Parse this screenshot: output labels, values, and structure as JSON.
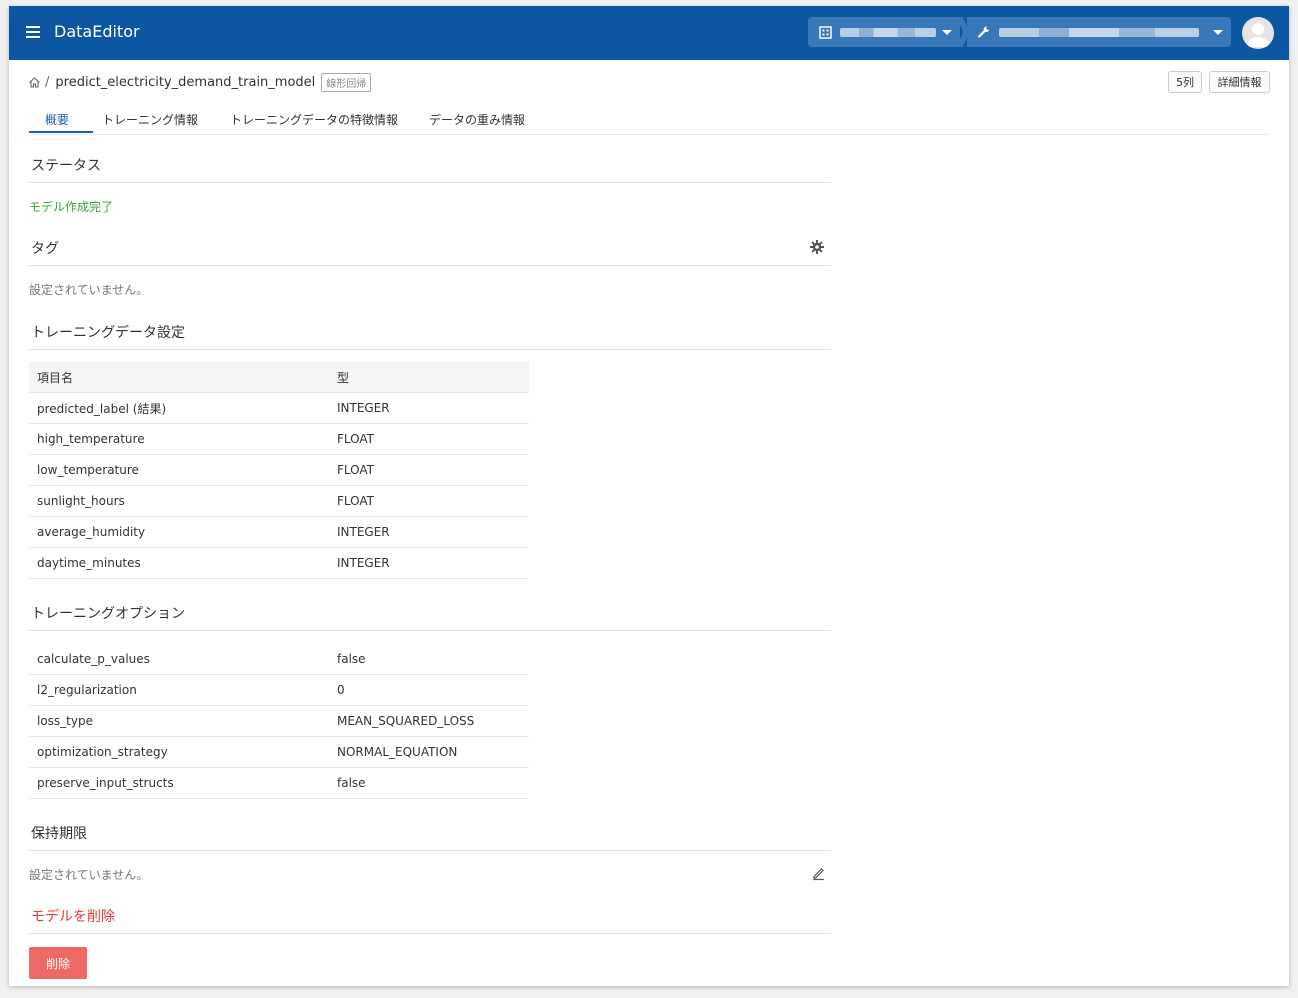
{
  "appbar": {
    "title": "DataEditor"
  },
  "breadcrumb": {
    "model_name": "predict_electricity_demand_train_model",
    "model_type": "線形回帰",
    "separator": "/"
  },
  "actions": {
    "columns_label": "5列",
    "details_label": "詳細情報"
  },
  "tabs": [
    {
      "label": "概要"
    },
    {
      "label": "トレーニング情報"
    },
    {
      "label": "トレーニングデータの特徴情報"
    },
    {
      "label": "データの重み情報"
    }
  ],
  "status": {
    "title": "ステータス",
    "value": "モデル作成完了"
  },
  "tags": {
    "title": "タグ",
    "empty_text": "設定されていません。"
  },
  "training_data": {
    "title": "トレーニングデータ設定",
    "headers": [
      "項目名",
      "型"
    ],
    "rows": [
      [
        "predicted_label (結果)",
        "INTEGER"
      ],
      [
        "high_temperature",
        "FLOAT"
      ],
      [
        "low_temperature",
        "FLOAT"
      ],
      [
        "sunlight_hours",
        "FLOAT"
      ],
      [
        "average_humidity",
        "INTEGER"
      ],
      [
        "daytime_minutes",
        "INTEGER"
      ]
    ]
  },
  "training_options": {
    "title": "トレーニングオプション",
    "rows": [
      [
        "calculate_p_values",
        "false"
      ],
      [
        "l2_regularization",
        "0"
      ],
      [
        "loss_type",
        "MEAN_SQUARED_LOSS"
      ],
      [
        "optimization_strategy",
        "NORMAL_EQUATION"
      ],
      [
        "preserve_input_structs",
        "false"
      ]
    ]
  },
  "retention": {
    "title": "保持期限",
    "empty_text": "設定されていません。"
  },
  "delete_section": {
    "title": "モデルを削除",
    "button_label": "削除"
  },
  "colors": {
    "appbar": "#0d57a2",
    "accent": "#1a5fb4",
    "success": "#3aa03a",
    "danger": "#e53935",
    "danger_button": "#ef6a66"
  }
}
